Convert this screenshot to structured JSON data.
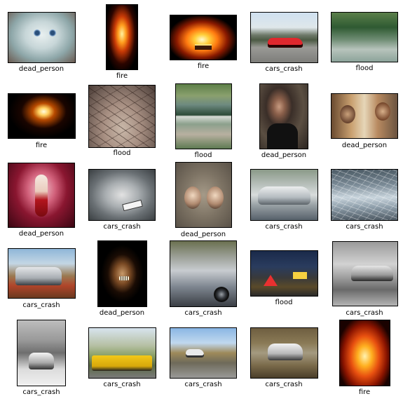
{
  "tiles": [
    {
      "label": "dead_person",
      "image": "blue-eyed pale doll face"
    },
    {
      "label": "fire",
      "image": "fire burning at night"
    },
    {
      "label": "fire",
      "image": "bonfire on black background"
    },
    {
      "label": "cars_crash",
      "image": "red car on street"
    },
    {
      "label": "flood",
      "image": "flooded road with palm trees"
    },
    {
      "label": "fire",
      "image": "lit candle in dark"
    },
    {
      "label": "flood",
      "image": "blurred branches"
    },
    {
      "label": "flood",
      "image": "aerial view of flooded area"
    },
    {
      "label": "dead_person",
      "image": "man in black t-shirt"
    },
    {
      "label": "dead_person",
      "image": "two women in warm room"
    },
    {
      "label": "dead_person",
      "image": "blonde woman in red costume"
    },
    {
      "label": "cars_crash",
      "image": "crumpled silver car front"
    },
    {
      "label": "dead_person",
      "image": "two children faces with Deads text"
    },
    {
      "label": "cars_crash",
      "image": "silver sedan with damaged front"
    },
    {
      "label": "cars_crash",
      "image": "car with shattered windshield"
    },
    {
      "label": "cars_crash",
      "image": "crashed white pickup truck"
    },
    {
      "label": "dead_person",
      "image": "face with open mouth in dark"
    },
    {
      "label": "cars_crash",
      "image": "wrecked car front"
    },
    {
      "label": "flood",
      "image": "night street with warning sign"
    },
    {
      "label": "cars_crash",
      "image": "black and white crashed car"
    },
    {
      "label": "cars_crash",
      "image": "black and white street crash"
    },
    {
      "label": "cars_crash",
      "image": "yellow tow truck with car"
    },
    {
      "label": "cars_crash",
      "image": "street with trees and cars"
    },
    {
      "label": "cars_crash",
      "image": "crashed white car in woods"
    },
    {
      "label": "fire",
      "image": "tall flames"
    }
  ]
}
